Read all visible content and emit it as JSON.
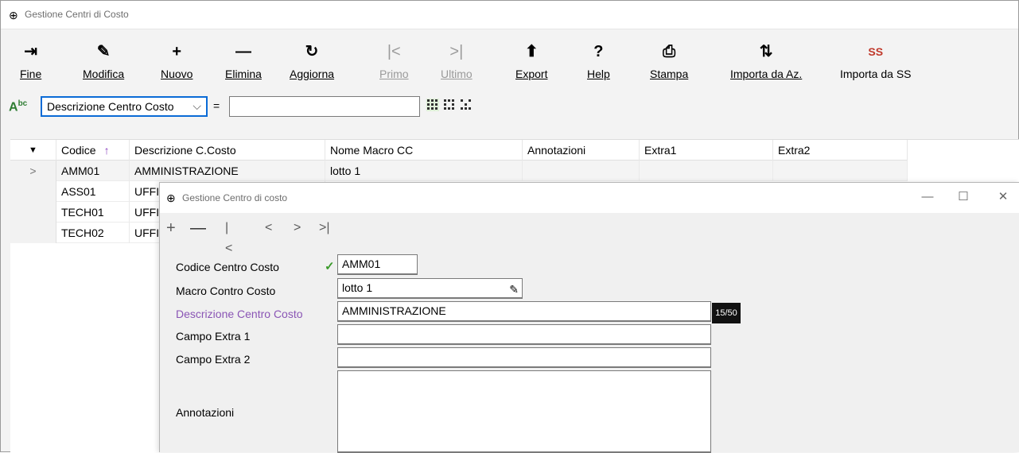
{
  "main_window": {
    "title": "Gestione Centri di Costo"
  },
  "toolbar": [
    {
      "id": "fine",
      "icon": "⇥",
      "label": "Fine",
      "enabled": true
    },
    {
      "id": "modifica",
      "icon": "✎",
      "label": "Modifica",
      "enabled": true
    },
    {
      "id": "nuovo",
      "icon": "+",
      "label": "Nuovo",
      "enabled": true
    },
    {
      "id": "elimina",
      "icon": "—",
      "label": "Elimina",
      "enabled": true
    },
    {
      "id": "aggiorna",
      "icon": "↻",
      "label": "Aggiorna",
      "enabled": true
    },
    {
      "id": "primo",
      "icon": "|<",
      "label": "Primo",
      "enabled": false
    },
    {
      "id": "ultimo",
      "icon": ">|",
      "label": "Ultimo",
      "enabled": false
    },
    {
      "id": "export",
      "icon": "⬆",
      "label": "Export",
      "enabled": true
    },
    {
      "id": "help",
      "icon": "?",
      "label": "Help",
      "enabled": true
    },
    {
      "id": "stampa",
      "icon": "⎙",
      "label": "Stampa",
      "enabled": true
    },
    {
      "id": "importa_az",
      "icon": "⇅",
      "label": "Importa da Az.",
      "enabled": true
    },
    {
      "id": "importa_ss",
      "icon": "SS",
      "label": "Importa da SS",
      "enabled": true
    }
  ],
  "filter": {
    "abc_icon": "A",
    "abc_sup": "bc",
    "field_selected": "Descrizione Centro Costo",
    "operator": "=",
    "value": ""
  },
  "grid": {
    "columns": [
      "Codice",
      "Descrizione C.Costo",
      "Nome Macro CC",
      "Annotazioni",
      "Extra1",
      "Extra2"
    ],
    "header_indicator": "▼",
    "sort_icon": "↑",
    "row_pointer": ">",
    "rows": [
      {
        "codice": "AMM01",
        "descrizione": "AMMINISTRAZIONE",
        "macro": "lotto 1",
        "annotazioni": "",
        "extra1": "",
        "extra2": ""
      },
      {
        "codice": "ASS01",
        "descrizione": "UFFIC",
        "macro": "",
        "annotazioni": "",
        "extra1": "",
        "extra2": ""
      },
      {
        "codice": "TECH01",
        "descrizione": "UFFIC",
        "macro": "",
        "annotazioni": "",
        "extra1": "",
        "extra2": ""
      },
      {
        "codice": "TECH02",
        "descrizione": "UFFIC",
        "macro": "",
        "annotazioni": "",
        "extra1": "",
        "extra2": ""
      }
    ]
  },
  "dialog": {
    "title": "Gestione Centro di costo",
    "window_buttons": {
      "minimize": "—",
      "maximize": "☐",
      "close": "✕"
    },
    "nav": {
      "add": "+",
      "delete": "—",
      "first": "|<",
      "prev": "<",
      "next": ">",
      "last": ">|"
    },
    "fields": {
      "codice": {
        "label": "Codice Centro Costo",
        "value": "AMM01",
        "valid_icon": "✓"
      },
      "macro": {
        "label": "Macro Contro Costo",
        "value": "lotto 1",
        "lookup_icon": "✎"
      },
      "descrizione": {
        "label": "Descrizione Centro Costo",
        "value": "AMMINISTRAZIONE",
        "counter": "15/50"
      },
      "extra1": {
        "label": "Campo Extra 1",
        "value": ""
      },
      "extra2": {
        "label": "Campo Extra 2",
        "value": ""
      },
      "annotazioni": {
        "label": "Annotazioni",
        "value": ""
      }
    }
  }
}
